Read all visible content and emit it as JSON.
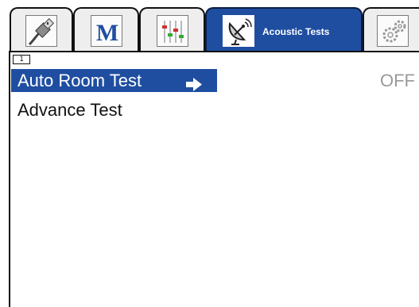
{
  "tabs": [
    {
      "icon": "usb-connector-icon",
      "label": ""
    },
    {
      "icon": "m-logo-icon",
      "label": ""
    },
    {
      "icon": "equalizer-icon",
      "label": ""
    },
    {
      "icon": "satellite-dish-icon",
      "label": "Acoustic Tests",
      "active": true
    },
    {
      "icon": "gears-icon",
      "label": ""
    }
  ],
  "page": {
    "indicator": "1"
  },
  "menu": {
    "items": [
      {
        "label": "Auto Room Test",
        "value": "OFF",
        "selected": true
      },
      {
        "label": "Advance Test",
        "value": ""
      }
    ]
  },
  "colors": {
    "accent": "#1f4ea1",
    "value_text": "#9a9a9a"
  }
}
